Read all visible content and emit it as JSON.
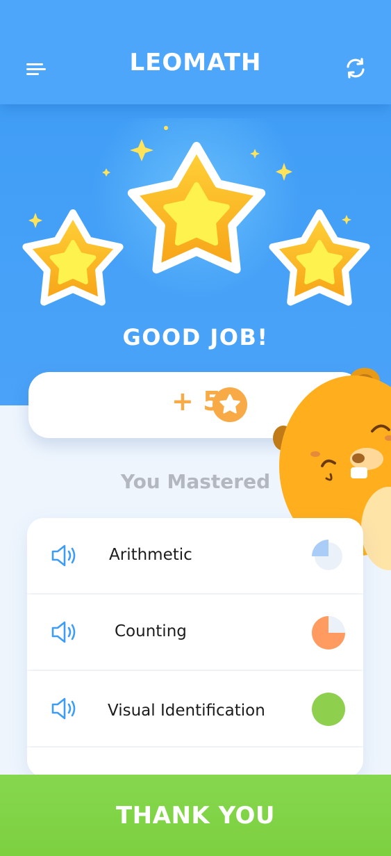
{
  "app": {
    "title": "LEOMATH"
  },
  "icons": {
    "menu": "menu-icon",
    "refresh": "refresh-icon",
    "coin": "star-coin-icon",
    "speaker": "speaker-icon"
  },
  "result": {
    "stars_earned": 3,
    "stars_total": 3,
    "message": "GOOD JOB!",
    "reward_text": "+ 50"
  },
  "mastered": {
    "title": "You Mastered",
    "items": [
      {
        "label": "Arithmetic",
        "progress": 0.25,
        "color": "#a9cdf6"
      },
      {
        "label": "Counting",
        "progress": 0.75,
        "color": "#ff9a60"
      },
      {
        "label": "Visual Identification",
        "progress": 1.0,
        "color": "#8ed04e"
      }
    ]
  },
  "footer": {
    "button_label": "THANK YOU"
  },
  "colors": {
    "primary_blue": "#4ea6fb",
    "reward_orange": "#f7aa45",
    "button_green": "#82d447",
    "background": "#eef5fd"
  }
}
